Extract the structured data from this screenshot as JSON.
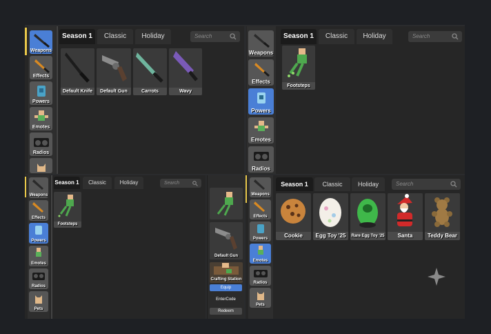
{
  "sidebar_labels": [
    "Weapons",
    "Effects",
    "Powers",
    "Emotes",
    "Radios",
    "Pets"
  ],
  "tabs": {
    "season": "Season 1",
    "classic": "Classic",
    "holiday": "Holiday"
  },
  "search_placeholder": "Search",
  "panel_top_left": {
    "items": [
      {
        "name": "Default Knife",
        "icon": "knife-icon"
      },
      {
        "name": "Default Gun",
        "icon": "gun-icon"
      },
      {
        "name": "Carrots",
        "icon": "knife-icon"
      },
      {
        "name": "Wavy",
        "icon": "knife-icon"
      }
    ]
  },
  "panel_top_right": {
    "items": [
      {
        "name": "Footsteps",
        "icon": "footsteps-icon"
      }
    ]
  },
  "panel_bottom_left": {
    "items": [
      {
        "name": "Footsteps",
        "icon": "footsteps-icon"
      }
    ]
  },
  "popup": {
    "items": [
      {
        "name": "",
        "icon": "footsteps-icon"
      },
      {
        "name": "Default Gun",
        "icon": "gun-icon"
      },
      {
        "name": "Crafting Station",
        "icon": "crafting-station-icon"
      }
    ],
    "buttons": {
      "equip": "Equip",
      "enter_code": "EnterCode",
      "redeem": "Redeem"
    }
  },
  "panel_bottom_right": {
    "items": [
      {
        "name": "Cookie",
        "icon": "cookie-icon"
      },
      {
        "name": "Egg Toy '25",
        "icon": "egg-icon"
      },
      {
        "name": "Rare Egg Toy '25",
        "icon": "green-egg-icon"
      },
      {
        "name": "Santa",
        "icon": "santa-icon"
      },
      {
        "name": "Teddy Bear",
        "icon": "teddy-bear-icon"
      }
    ]
  },
  "colors": {
    "accent_selected": "#4a7fd6",
    "highlight": "#e9c84a"
  }
}
